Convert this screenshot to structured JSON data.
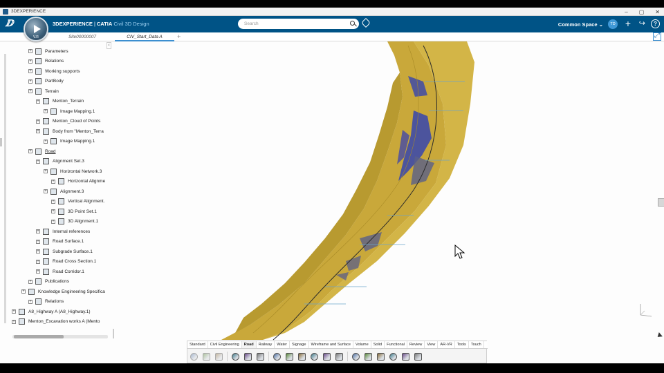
{
  "window": {
    "title": "3DEXPERIENCE",
    "controls": [
      "–",
      "▢",
      "✕"
    ]
  },
  "appbar": {
    "brand_prefix": "3DEXPERIENCE",
    "brand_separator": "|",
    "brand_product": "CATIA",
    "brand_app": "Civil 3D Design",
    "compass_version": "V.R",
    "search_placeholder": "Search",
    "collab_space": "Common Space",
    "avatar_initials": "TD",
    "colors": {
      "bar": "#005386",
      "accent": "#3c8fd0"
    }
  },
  "tabs": [
    {
      "label": "Site00000007",
      "active": false
    },
    {
      "label": "CIV_Start_Data A",
      "active": true
    }
  ],
  "tab_add": "+",
  "tree": {
    "collapse_glyph": "‹",
    "nodes": [
      {
        "label": "Parameters",
        "level": 3,
        "icon": "parameters-icon"
      },
      {
        "label": "Relations",
        "level": 3,
        "icon": "relations-icon"
      },
      {
        "label": "Working supports",
        "level": 3,
        "icon": "grid-icon"
      },
      {
        "label": "PartBody",
        "level": 3,
        "icon": "partbody-icon"
      },
      {
        "label": "Terrain",
        "level": 3,
        "icon": "terrain-icon"
      },
      {
        "label": "Menton_Terrain",
        "level": 4,
        "icon": "terrain-mesh-icon"
      },
      {
        "label": "Image Mapping.1",
        "level": 5,
        "icon": "image-mapping-icon"
      },
      {
        "label": "Menton_Cloud of Points",
        "level": 4,
        "icon": "cloud-points-icon"
      },
      {
        "label": "Body from \"Menton_Terra",
        "level": 4,
        "icon": "body-icon"
      },
      {
        "label": "Image Mapping.1",
        "level": 5,
        "icon": "image-mapping-icon"
      },
      {
        "label": "Road",
        "level": 3,
        "icon": "road-icon",
        "underlined": true
      },
      {
        "label": "Alignment Set.3",
        "level": 4,
        "icon": "alignment-set-icon"
      },
      {
        "label": "Horizontal Network.3",
        "level": 5,
        "icon": "horizontal-network-icon"
      },
      {
        "label": "Horizontal Alignme",
        "level": 6,
        "icon": "horizontal-alignment-icon"
      },
      {
        "label": "Alignment.3",
        "level": 5,
        "icon": "alignment-icon"
      },
      {
        "label": "Vertical Alignment.",
        "level": 6,
        "icon": "vertical-alignment-icon"
      },
      {
        "label": "3D Point Set.1",
        "level": 6,
        "icon": "point-set-icon"
      },
      {
        "label": "3D Alignment.1",
        "level": 6,
        "icon": "3d-alignment-icon"
      },
      {
        "label": "Internal references",
        "level": 4,
        "icon": "internal-references-icon"
      },
      {
        "label": "Road Surface.1",
        "level": 4,
        "icon": "road-surface-icon"
      },
      {
        "label": "Subgrade Surface.1",
        "level": 4,
        "icon": "subgrade-surface-icon"
      },
      {
        "label": "Road Cross Section.1",
        "level": 4,
        "icon": "cross-section-icon"
      },
      {
        "label": "Road Corridor.1",
        "level": 4,
        "icon": "corridor-icon"
      },
      {
        "label": "Publications",
        "level": 3,
        "icon": "publications-icon"
      },
      {
        "label": "Knowledge Engineering Specifica",
        "level": 2,
        "icon": "knowledge-icon"
      },
      {
        "label": "Relations",
        "level": 3,
        "icon": "relations-icon"
      },
      {
        "label": "A8_Highway A (A8_Highway.1)",
        "level": 1,
        "icon": "product-icon"
      },
      {
        "label": "Menton_Excavation works A (Mento",
        "level": 1,
        "icon": "product-icon"
      }
    ]
  },
  "action_bar": {
    "sections": [
      "Standard",
      "Civil Engineering",
      "Road",
      "Railway",
      "Water",
      "Signage",
      "Wireframe and Surface",
      "Volume",
      "Solid",
      "Functional",
      "Review",
      "View",
      "AR-VR",
      "Tools",
      "Touch"
    ],
    "active_section": "Road",
    "tools": [
      {
        "name": "cut-icon",
        "dim": true
      },
      {
        "name": "copy-icon",
        "dim": true
      },
      {
        "name": "paste-icon",
        "dim": true
      },
      {
        "name": "undo-icon",
        "dim": false
      },
      {
        "name": "fit-all-icon",
        "dim": false
      },
      {
        "name": "update-icon",
        "dim": false
      },
      {
        "name": "alignment-tool-icon",
        "dim": false
      },
      {
        "name": "profile-tool-icon",
        "dim": false
      },
      {
        "name": "network-tool-icon",
        "dim": false
      },
      {
        "name": "corridor-tool-icon",
        "dim": false
      },
      {
        "name": "surface-tool-icon",
        "dim": false
      },
      {
        "name": "cross-section-tool-icon",
        "dim": false
      },
      {
        "name": "slope-tool-icon",
        "dim": false
      },
      {
        "name": "edge-tool-icon",
        "dim": false
      },
      {
        "name": "axis-tool-icon",
        "dim": false
      },
      {
        "name": "building-tool-icon",
        "dim": false
      },
      {
        "name": "parts-tool-icon",
        "dim": false
      },
      {
        "name": "assembly-tool-icon",
        "dim": false
      }
    ]
  },
  "viewport": {
    "colors": {
      "road_surface": "#c9a83a",
      "road_edge": "#a88a26",
      "slope_fill": "#5a5f8a",
      "cut_faces": "#3e4aa8",
      "centerline": "#2a2a2a"
    }
  }
}
